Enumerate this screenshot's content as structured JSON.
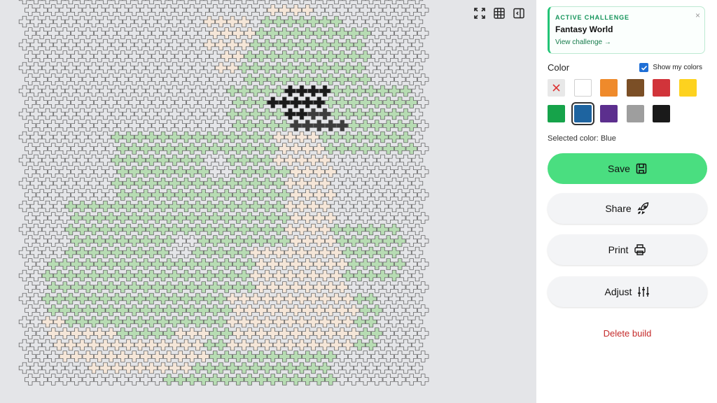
{
  "board": {
    "rows": 34,
    "cols": 35,
    "colors": {
      "empty": "#e4e5e8",
      "outline": "#555555",
      "green": "#b7dcb3",
      "cream": "#f5e6d8",
      "black": "#1b1b1b",
      "darkgray": "#3d3d3d"
    },
    "regions": {
      "green": [
        [
          2,
          21,
          2,
          27
        ],
        [
          3,
          19,
          7,
          29
        ],
        [
          8,
          18,
          13,
          33
        ],
        [
          12,
          8,
          17,
          26
        ],
        [
          16,
          10,
          30,
          22
        ],
        [
          18,
          4,
          27,
          10
        ],
        [
          20,
          23,
          24,
          32
        ],
        [
          26,
          5,
          30,
          30
        ],
        [
          28,
          12,
          33,
          26
        ],
        [
          23,
          2,
          29,
          6
        ]
      ],
      "cream": [
        [
          1,
          21,
          1,
          24
        ],
        [
          2,
          16,
          4,
          19
        ],
        [
          4,
          17,
          6,
          18
        ],
        [
          12,
          22,
          14,
          25
        ],
        [
          14,
          23,
          24,
          26
        ],
        [
          22,
          20,
          27,
          27
        ],
        [
          26,
          18,
          30,
          28
        ],
        [
          28,
          2,
          29,
          3
        ],
        [
          29,
          3,
          31,
          7
        ],
        [
          30,
          6,
          32,
          14
        ],
        [
          29,
          13,
          31,
          15
        ]
      ],
      "black": [
        [
          8,
          23,
          8,
          26
        ],
        [
          9,
          21,
          9,
          25
        ],
        [
          10,
          23,
          10,
          24
        ]
      ],
      "darkgray": [
        [
          10,
          25,
          10,
          26
        ],
        [
          11,
          23,
          11,
          27
        ]
      ],
      "empty": [
        [
          14,
          16,
          15,
          17
        ],
        [
          21,
          13,
          22,
          14
        ],
        [
          15,
          33,
          17,
          34
        ],
        [
          33,
          29,
          33,
          34
        ]
      ]
    }
  },
  "toolbar": {
    "icons": [
      "expand-icon",
      "grid-icon",
      "collapse-sidebar-icon"
    ]
  },
  "challenge": {
    "kicker": "ACTIVE CHALLENGE",
    "title": "Fantasy World",
    "link": "View challenge →",
    "close": "×"
  },
  "palette": {
    "label": "Color",
    "show_mine_label": "Show my colors",
    "show_mine_checked": true,
    "swatches": [
      {
        "name": "none",
        "hex": "#e8e8e8"
      },
      {
        "name": "White",
        "hex": "#ffffff"
      },
      {
        "name": "Orange",
        "hex": "#ef8a2b"
      },
      {
        "name": "Brown",
        "hex": "#7b4f26"
      },
      {
        "name": "Red",
        "hex": "#d1343a"
      },
      {
        "name": "Yellow",
        "hex": "#fdd21f"
      },
      {
        "name": "Green",
        "hex": "#16a34a"
      },
      {
        "name": "Blue",
        "hex": "#1e64a0"
      },
      {
        "name": "Purple",
        "hex": "#5c2f8e"
      },
      {
        "name": "Gray",
        "hex": "#9e9e9e"
      },
      {
        "name": "Black",
        "hex": "#1a1a1a"
      }
    ],
    "selected_index": 7,
    "selected_text": "Selected color: Blue"
  },
  "actions": {
    "save": "Save",
    "share": "Share",
    "print": "Print",
    "adjust": "Adjust",
    "delete": "Delete build"
  },
  "accent": "#4ade80"
}
